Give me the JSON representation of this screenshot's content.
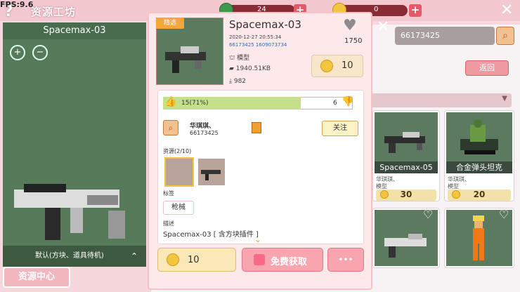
{
  "fps": "FPS:9.6",
  "app_title": "资源工坊",
  "currency": {
    "gems": "24",
    "coins": "0"
  },
  "search": {
    "value": "66173425"
  },
  "back_label": "返回",
  "resource_center_label": "资源中心",
  "preview": {
    "title": "Spacemax-03",
    "footer": "默认(方块、道具待机)"
  },
  "grid_cards": [
    {
      "name": "Spacemax-05",
      "author": "华琪琪、",
      "type": "模型",
      "price": "30"
    },
    {
      "name": "合金弹头坦克",
      "author": "华琪琪、",
      "type": "模型",
      "price": "20"
    }
  ],
  "detail": {
    "tag": "精选",
    "title": "Spacemax-03",
    "date": "2020-12-27  20:55:34",
    "ids": "66173425  1609073734",
    "type": "模型",
    "size": "1940.51KB",
    "downloads": "982",
    "favorites": "1750",
    "price": "10",
    "likes_label": "15(71%)",
    "dislikes": "6",
    "author_name": "华琪琪、",
    "author_id": "66173425",
    "follow_label": "关注",
    "resources_label": "资源(2/10)",
    "tags_label": "标签",
    "tag_value": "枪械",
    "desc_label": "描述",
    "desc_value": "Spacemax-03 [ 含方块插件 ]",
    "buy_price": "10",
    "free_get_label": "免费获取",
    "more_label": "•••"
  }
}
